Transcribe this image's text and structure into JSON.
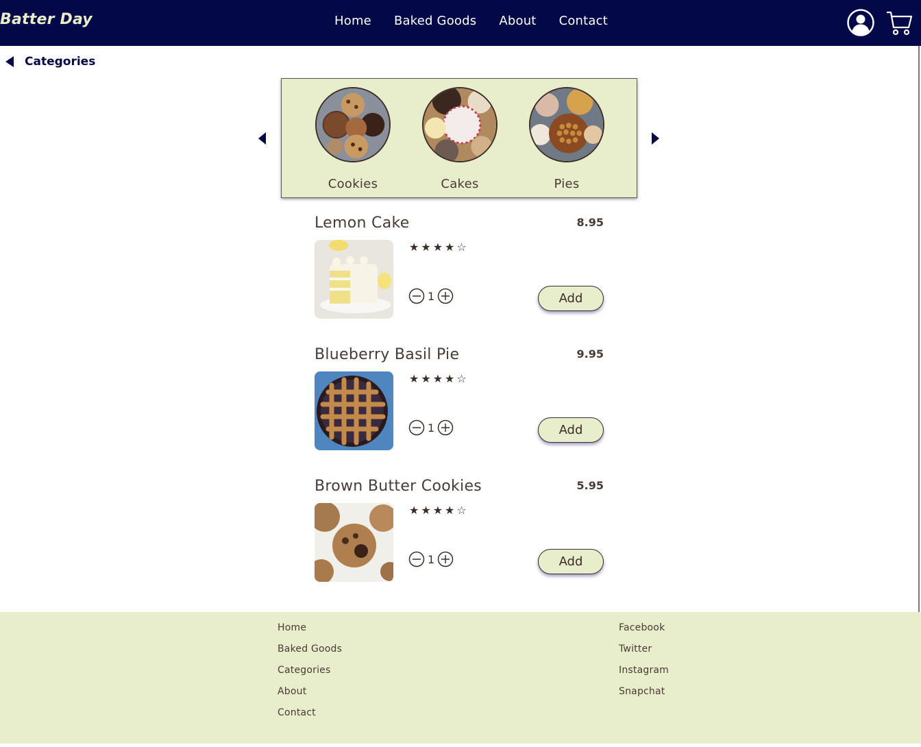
{
  "header": {
    "brand": "Batter Day",
    "nav": [
      "Home",
      "Baked Goods",
      "About",
      "Contact"
    ],
    "user_icon": "user-circle-icon",
    "cart_icon": "shopping-cart-icon"
  },
  "back_link": {
    "label": "Categories"
  },
  "categories": [
    {
      "label": "Cookies"
    },
    {
      "label": "Cakes"
    },
    {
      "label": "Pies"
    }
  ],
  "products": [
    {
      "name": "Lemon Cake",
      "price": "8.95",
      "rating": 4,
      "rating_max": 5,
      "qty": "1",
      "add_label": "Add"
    },
    {
      "name": "Blueberry Basil Pie",
      "price": "9.95",
      "rating": 4,
      "rating_max": 5,
      "qty": "1",
      "add_label": "Add"
    },
    {
      "name": "Brown Butter Cookies",
      "price": "5.95",
      "rating": 4,
      "rating_max": 5,
      "qty": "1",
      "add_label": "Add"
    }
  ],
  "footer": {
    "left": [
      "Home",
      "Baked Goods",
      "Categories",
      "About",
      "Contact"
    ],
    "right": [
      "Facebook",
      "Twitter",
      "Instagram",
      "Snapchat"
    ]
  },
  "colors": {
    "navy": "#030848",
    "cream": "#e8edcb",
    "text": "#4a3a36"
  }
}
